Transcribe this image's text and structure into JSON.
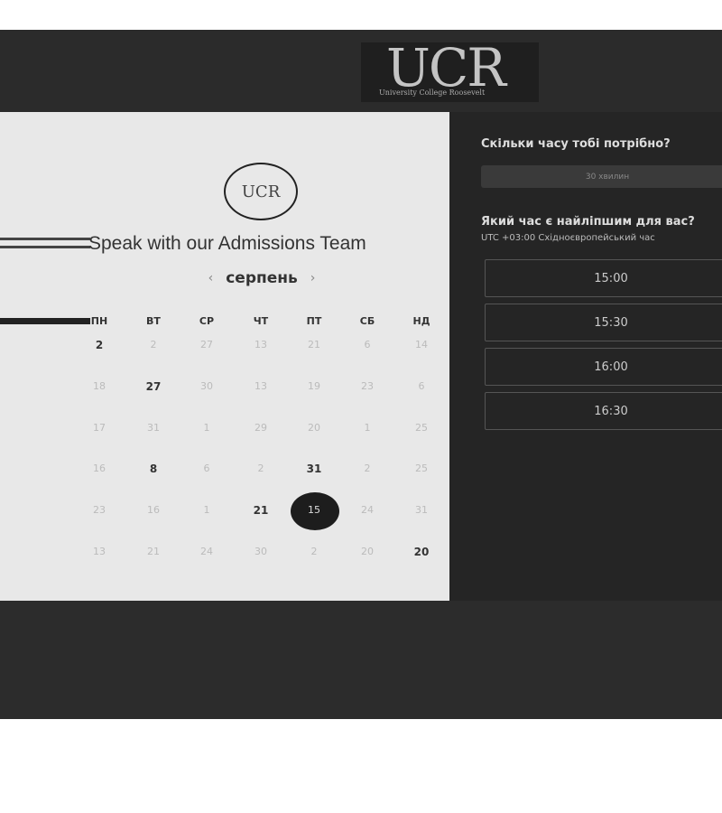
{
  "header": {
    "logo_text": "UCR",
    "logo_subtitle": "University College Roosevelt"
  },
  "left": {
    "badge_text": "UCR",
    "title": "Speak with our Admissions Team",
    "month": "серпень",
    "prev_icon": "chevron-left-icon",
    "next_icon": "chevron-right-icon",
    "weekdays": [
      "ПН",
      "ВТ",
      "СР",
      "ЧТ",
      "ПТ",
      "СБ",
      "НД"
    ],
    "rows": [
      [
        "2",
        "2",
        "27",
        "13",
        "21",
        "6",
        "14"
      ],
      [
        "18",
        "27",
        "30",
        "13",
        "19",
        "23",
        "6"
      ],
      [
        "17",
        "31",
        "1",
        "29",
        "20",
        "1",
        "25"
      ],
      [
        "16",
        "8",
        "6",
        "2",
        "31",
        "2",
        "25"
      ],
      [
        "23",
        "16",
        "1",
        "21",
        "15",
        "24",
        "31"
      ],
      [
        "13",
        "21",
        "24",
        "30",
        "2",
        "20",
        "20"
      ]
    ],
    "available": [
      [
        0,
        0
      ],
      [
        1,
        1
      ],
      [
        3,
        1
      ],
      [
        3,
        4
      ],
      [
        4,
        3
      ],
      [
        5,
        6
      ]
    ],
    "selected": [
      4,
      4
    ]
  },
  "right": {
    "duration_question": "Скільки часу тобі потрібно?",
    "duration_value": "30 хвилин",
    "time_question": "Який час є найліпшим для вас?",
    "timezone": "UTC +03:00 Східноєвропейський час",
    "slots": [
      "15:00",
      "15:30",
      "16:00",
      "16:30"
    ]
  }
}
